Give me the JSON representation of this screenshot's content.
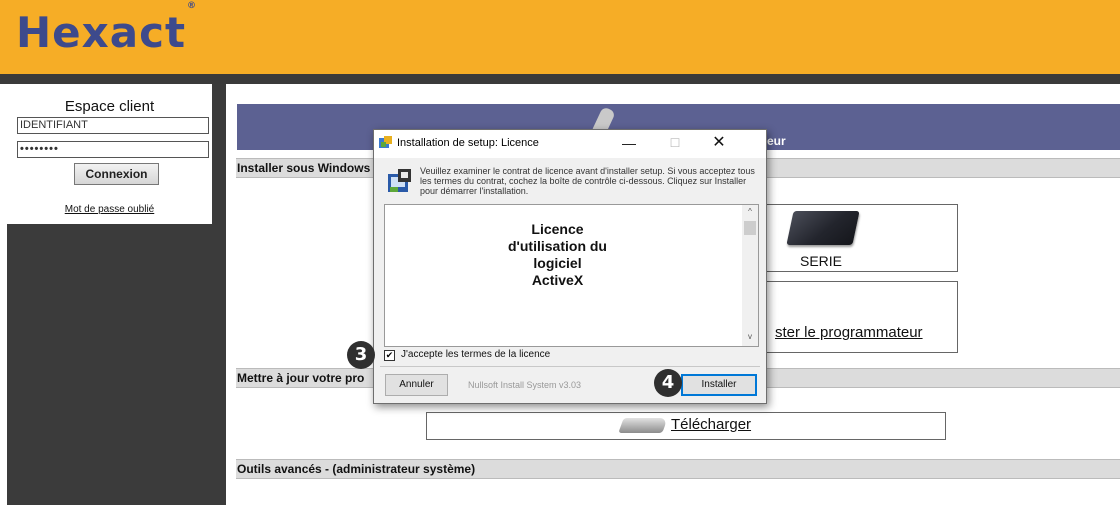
{
  "header": {
    "logo": "Hexact",
    "logo_mark": "®"
  },
  "sidebar": {
    "title": "Espace client",
    "identifiant_value": "IDENTIFIANT",
    "password_value": "••••••••",
    "connexion_label": "Connexion",
    "forgot_label": "Mot de passe oublié"
  },
  "main": {
    "title_bar_label": "eur",
    "section_install": "Installer sous Windows",
    "serie_label": "SERIE",
    "prog_label": "ster le programmateur",
    "section_update": "Mettre à jour votre pro",
    "download_label": "Télécharger",
    "section_tools": "Outils avancés - (administrateur système)"
  },
  "dialog": {
    "title": "Installation de setup: Licence",
    "min_glyph": "—",
    "max_glyph": "☐",
    "close_glyph": "✕",
    "message": "Veuillez examiner le contrat de licence avant d'installer setup. Si vous acceptez tous les termes du contrat, cochez la boîte de contrôle ci-dessous. Cliquez sur Installer pour démarrer l'installation.",
    "license_text": "Licence\nd'utilisation du\nlogiciel\nActiveX",
    "scroll_up": "^",
    "scroll_down": "v",
    "checkbox_mark": "✔",
    "checkbox_label": "J'accepte les termes de la licence",
    "cancel_label": "Annuler",
    "nullsoft_label": "Nullsoft Install System v3.03",
    "install_label": "Installer"
  },
  "badges": {
    "step3": "3",
    "step4": "4"
  },
  "colors": {
    "header": "#f6ad26",
    "logo": "#3d4a8c",
    "sidebar": "#3b3b3b",
    "title_bar": "#5c6192",
    "section": "#dcdcdc"
  }
}
